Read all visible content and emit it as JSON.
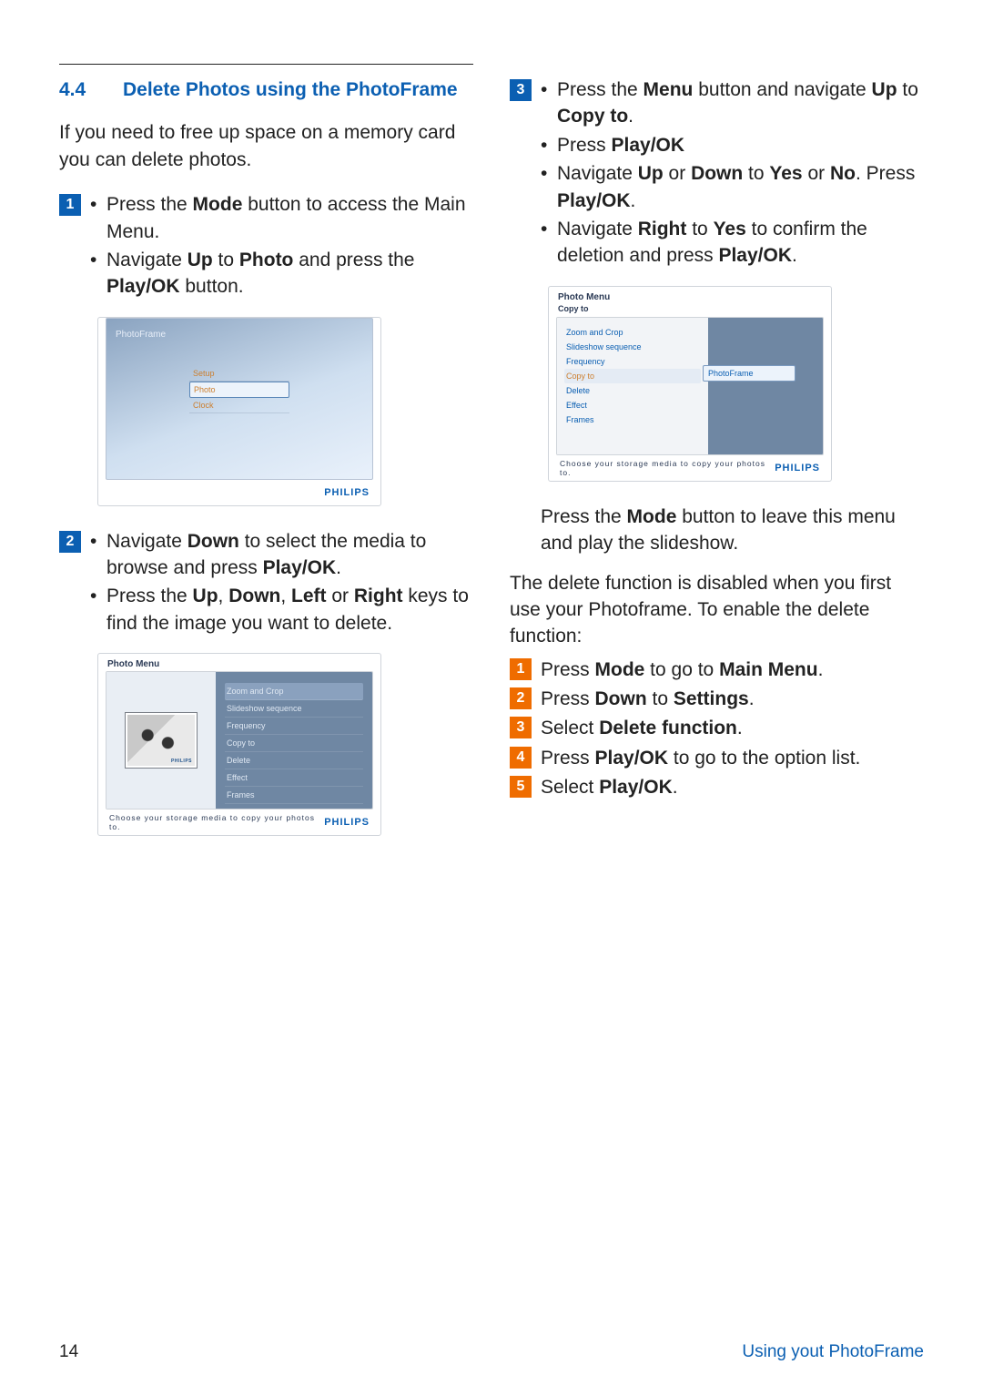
{
  "section": {
    "number": "4.4",
    "title": "Delete Photos using the PhotoFrame"
  },
  "intro": "If you need to free up space on a memory card you can delete photos.",
  "brand": "PHILIPS",
  "storage_msg": "Choose your storage media to copy your photos to.",
  "step1": {
    "num": "1",
    "a1": "Press the ",
    "a2": "Mode",
    "a3": " button to access the Main Menu.",
    "b1": "Navigate ",
    "b2": "Up",
    "b3": " to ",
    "b4": "Photo",
    "b5": " and press the ",
    "b6": "Play/OK",
    "b7": " button."
  },
  "mock1": {
    "label": "PhotoFrame",
    "items": {
      "setup": "Setup",
      "photo": "Photo",
      "clock": "Clock"
    }
  },
  "step2": {
    "num": "2",
    "a1": "Navigate ",
    "a2": "Down",
    "a3": " to select the media to browse and press ",
    "a4": "Play/OK",
    "a5": ".",
    "b1": "Press the ",
    "b2": "Up",
    "b3": ", ",
    "b4": "Down",
    "b5": ", ",
    "b6": "Left",
    "b7": " or ",
    "b8": "Right",
    "b9": " keys to find the image you want to delete."
  },
  "mock2": {
    "title": "Photo Menu",
    "items": {
      "zoom": "Zoom and Crop",
      "slideshow": "Slideshow sequence",
      "freq": "Frequency",
      "copy": "Copy to",
      "delete": "Delete",
      "effect": "Effect",
      "frames": "Frames"
    }
  },
  "step3": {
    "num": "3",
    "a1": "Press the ",
    "a2": "Menu",
    "a3": " button and navigate ",
    "a4": "Up",
    "a5": " to ",
    "a6": "Copy to",
    "a7": ".",
    "b1": "Press ",
    "b2": "Play/OK",
    "c1": "Navigate ",
    "c2": "Up",
    "c3": " or ",
    "c4": "Down",
    "c5": " to ",
    "c6": "Yes",
    "c7": " or ",
    "c8": "No",
    "c9": ". Press ",
    "c10": "Play/OK",
    "c11": ".",
    "d1": "Navigate ",
    "d2": "Right",
    "d3": " to ",
    "d4": "Yes",
    "d5": " to confirm the deletion and press ",
    "d6": "Play/OK",
    "d7": "."
  },
  "mock3": {
    "title": "Photo Menu",
    "sub": "Copy to",
    "panel": "PhotoFrame",
    "items": {
      "zoom": "Zoom and Crop",
      "slideshow": "Slideshow sequence",
      "freq": "Frequency",
      "copy": "Copy to",
      "delete": "Delete",
      "effect": "Effect",
      "frames": "Frames"
    }
  },
  "note": {
    "t1": "Press the ",
    "t2": "Mode",
    "t3": " button to leave this menu and play the slideshow."
  },
  "disabled_intro": "The delete function is disabled when you first use your Photoframe. To enable the delete function:",
  "enable": {
    "s1": {
      "num": "1",
      "a": "Press ",
      "b": "Mode",
      "c": " to go to ",
      "d": "Main Menu",
      "e": "."
    },
    "s2": {
      "num": "2",
      "a": "Press ",
      "b": "Down",
      "c": " to ",
      "d": "Settings",
      "e": "."
    },
    "s3": {
      "num": "3",
      "a": "Select ",
      "b": "Delete function",
      "c": "."
    },
    "s4": {
      "num": "4",
      "a": "Press ",
      "b": "Play/OK",
      "c": " to go to the option list."
    },
    "s5": {
      "num": "5",
      "a": "Select ",
      "b": "Play/OK",
      "c": "."
    }
  },
  "footer": {
    "page": "14",
    "right": "Using yout PhotoFrame"
  }
}
